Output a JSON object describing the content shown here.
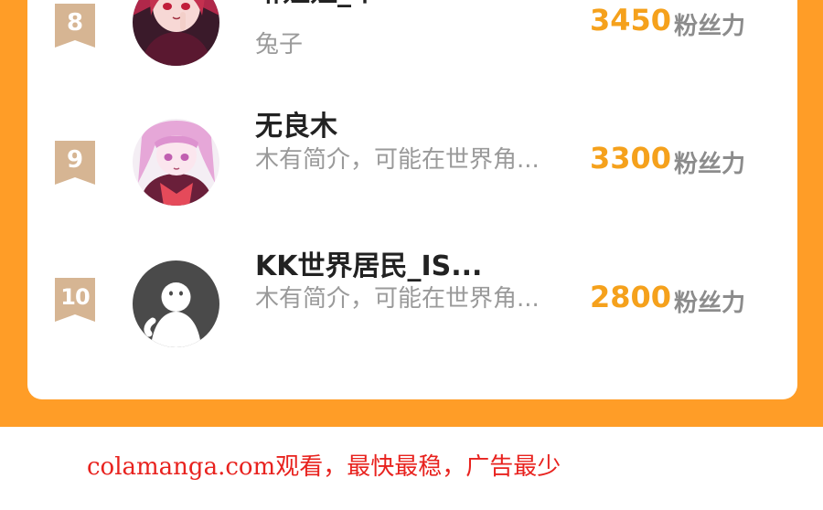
{
  "colors": {
    "background": "#ff9d27",
    "card": "#ffffff",
    "fan_count": "#f5a11c",
    "rank_badge": "#d6b593",
    "name": "#222222",
    "description": "#9a9a9a",
    "unit": "#8c8c8c",
    "watermark": "#e8221e"
  },
  "fans_list": [
    {
      "rank": "8",
      "name": "琳姐姐_丫",
      "description": "兔子",
      "fans": "3450",
      "unit": "粉丝力",
      "avatar_icon": "anime-girl-red-hair-avatar"
    },
    {
      "rank": "9",
      "name": "无良木",
      "description": "木有简介，可能在世界角...",
      "fans": "3300",
      "unit": "粉丝力",
      "avatar_icon": "anime-girl-pink-hair-avatar"
    },
    {
      "rank": "10",
      "name": "KK世界居民_IS...",
      "description": "木有简介，可能在世界角...",
      "fans": "2800",
      "unit": "粉丝力",
      "avatar_icon": "default-user-avatar"
    }
  ],
  "watermark": "colamanga.com观看，最快最稳，广告最少"
}
